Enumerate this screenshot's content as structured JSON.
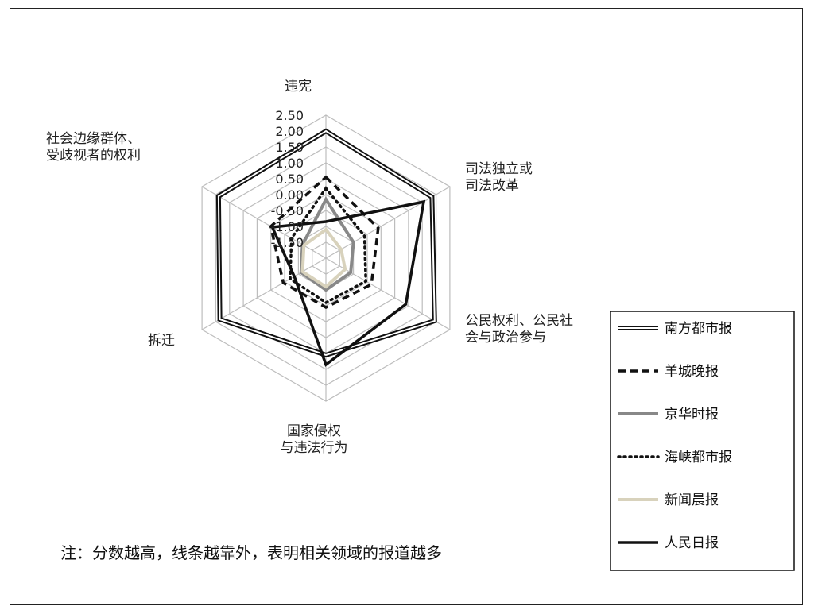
{
  "note": "注：分数越高，线条越靠外，表明相关领域的报道越多",
  "chart_data": {
    "type": "radar",
    "axes": [
      [
        "违宪"
      ],
      [
        "司法独立或",
        "司法改革"
      ],
      [
        "公民权利、公民社",
        "会与政治参与"
      ],
      [
        "国家侵权",
        "与违法行为"
      ],
      [
        "拆迁"
      ],
      [
        "社会边缘群体、",
        "受歧视者的权利"
      ]
    ],
    "ticks": [
      "-1.50",
      "-1.00",
      "-0.50",
      "0.00",
      "0.50",
      "1.00",
      "1.50",
      "2.00",
      "2.50"
    ],
    "range": [
      -2.0,
      2.5
    ],
    "grid": true,
    "legend_position": "right",
    "series": [
      {
        "name": "南方都市报",
        "style": "double",
        "color": "#111111",
        "values": [
          2.0,
          1.85,
          1.95,
          1.05,
          1.85,
          1.9
        ]
      },
      {
        "name": "羊城晚报",
        "style": "dashed",
        "color": "#111111",
        "values": [
          0.55,
          -0.1,
          -0.35,
          -0.45,
          -0.45,
          0.0
        ]
      },
      {
        "name": "京华时报",
        "style": "solid-gray",
        "color": "#888888",
        "values": [
          -0.15,
          -1.0,
          -1.1,
          -1.0,
          -1.1,
          -1.15
        ]
      },
      {
        "name": "海峡都市报",
        "style": "dotted",
        "color": "#111111",
        "values": [
          0.2,
          -0.6,
          -0.55,
          -0.6,
          -0.7,
          -0.75
        ]
      },
      {
        "name": "新闻晨报",
        "style": "solid-beige",
        "color": "#d8d2bc",
        "values": [
          -1.1,
          -1.45,
          -1.3,
          -1.1,
          -1.15,
          -1.2
        ]
      },
      {
        "name": "人民日报",
        "style": "solid",
        "color": "#111111",
        "values": [
          -0.85,
          1.55,
          0.9,
          1.35,
          -0.85,
          -0.05
        ]
      }
    ]
  }
}
